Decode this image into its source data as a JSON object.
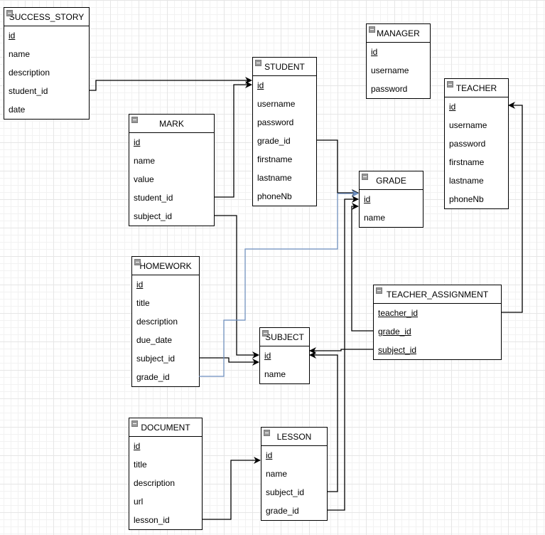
{
  "tables": {
    "success_story": {
      "title": "SUCCESS_STORY",
      "fields": [
        {
          "name": "id",
          "pk": true
        },
        {
          "name": "name"
        },
        {
          "name": "description"
        },
        {
          "name": "student_id"
        },
        {
          "name": "date"
        }
      ]
    },
    "manager": {
      "title": "MANAGER",
      "fields": [
        {
          "name": "id",
          "pk": true
        },
        {
          "name": "username"
        },
        {
          "name": "password"
        }
      ]
    },
    "student": {
      "title": "STUDENT",
      "fields": [
        {
          "name": "id",
          "pk": true
        },
        {
          "name": "username"
        },
        {
          "name": "password"
        },
        {
          "name": "grade_id"
        },
        {
          "name": "firstname"
        },
        {
          "name": "lastname"
        },
        {
          "name": "phoneNb"
        }
      ]
    },
    "teacher": {
      "title": "TEACHER",
      "fields": [
        {
          "name": "id",
          "pk": true
        },
        {
          "name": "username"
        },
        {
          "name": "password"
        },
        {
          "name": "firstname"
        },
        {
          "name": "lastname"
        },
        {
          "name": "phoneNb"
        }
      ]
    },
    "mark": {
      "title": "MARK",
      "fields": [
        {
          "name": "id",
          "pk": true
        },
        {
          "name": "name"
        },
        {
          "name": "value"
        },
        {
          "name": "student_id"
        },
        {
          "name": "subject_id"
        }
      ]
    },
    "grade": {
      "title": "GRADE",
      "fields": [
        {
          "name": "id",
          "pk": true
        },
        {
          "name": "name"
        }
      ]
    },
    "homework": {
      "title": "HOMEWORK",
      "fields": [
        {
          "name": "id",
          "pk": true
        },
        {
          "name": "title"
        },
        {
          "name": "description"
        },
        {
          "name": "due_date"
        },
        {
          "name": "subject_id"
        },
        {
          "name": "grade_id"
        }
      ]
    },
    "teacher_assignment": {
      "title": "TEACHER_ASSIGNMENT",
      "fields": [
        {
          "name": "teacher_id",
          "pk": true
        },
        {
          "name": "grade_id",
          "pk": true
        },
        {
          "name": "subject_id",
          "pk": true
        }
      ]
    },
    "subject": {
      "title": "SUBJECT",
      "fields": [
        {
          "name": "id",
          "pk": true
        },
        {
          "name": "name"
        }
      ]
    },
    "document": {
      "title": "DOCUMENT",
      "fields": [
        {
          "name": "id",
          "pk": true
        },
        {
          "name": "title"
        },
        {
          "name": "description"
        },
        {
          "name": "url"
        },
        {
          "name": "lesson_id"
        }
      ]
    },
    "lesson": {
      "title": "LESSON",
      "fields": [
        {
          "name": "id",
          "pk": true
        },
        {
          "name": "name"
        },
        {
          "name": "subject_id"
        },
        {
          "name": "grade_id"
        }
      ]
    }
  },
  "relations": [
    {
      "from": "success_story.student_id",
      "to": "student.id"
    },
    {
      "from": "mark.student_id",
      "to": "student.id"
    },
    {
      "from": "student.grade_id",
      "to": "grade.id"
    },
    {
      "from": "homework.grade_id",
      "to": "grade.id",
      "selected": true
    },
    {
      "from": "mark.subject_id",
      "to": "subject.id"
    },
    {
      "from": "homework.subject_id",
      "to": "subject.id"
    },
    {
      "from": "teacher_assignment.grade_id",
      "to": "grade.id"
    },
    {
      "from": "teacher_assignment.teacher_id",
      "to": "teacher.id"
    },
    {
      "from": "teacher_assignment.subject_id",
      "to": "subject.id"
    },
    {
      "from": "lesson.subject_id",
      "to": "subject.id"
    },
    {
      "from": "lesson.grade_id",
      "to": "grade.id"
    },
    {
      "from": "document.lesson_id",
      "to": "lesson.id"
    }
  ],
  "colors": {
    "edge": "#000000",
    "selected_edge": "#6c8ebf"
  }
}
